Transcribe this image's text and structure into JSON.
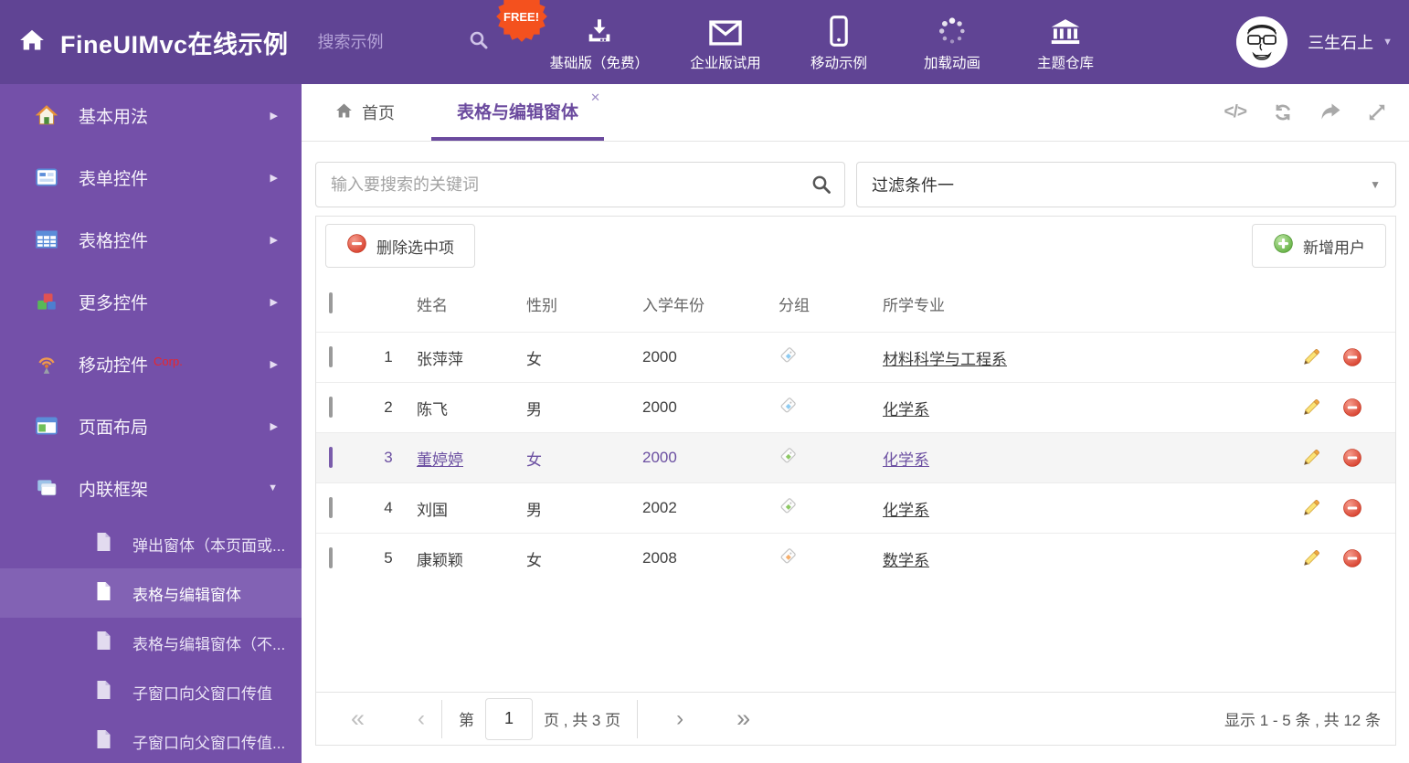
{
  "colors": {
    "header_bg": "#604494",
    "sidebar_bg": "#7450A9",
    "sidebar_active_bg": "#8262B4",
    "accent_purple": "#6B4A9E",
    "free_badge_orange": "#F4511E",
    "delete_red": "#DD3E2B",
    "add_green": "#6FBF4C",
    "selected_row_bg": "#F5F5F5"
  },
  "glyphs": {
    "code": "</>",
    "close": "✕",
    "caret_down": "▼",
    "arrow_right": "▶",
    "first": "«",
    "prev": "‹",
    "next": "›",
    "last": "»"
  },
  "header": {
    "title": "FineUIMvc在线示例",
    "search_placeholder": "搜索示例",
    "nav": [
      {
        "label": "基础版（免费）",
        "badge": "FREE!"
      },
      {
        "label": "企业版试用"
      },
      {
        "label": "移动示例"
      },
      {
        "label": "加载动画"
      },
      {
        "label": "主题仓库"
      }
    ],
    "user_name": "三生石上"
  },
  "sidebar": {
    "items": [
      {
        "label": "基本用法"
      },
      {
        "label": "表单控件"
      },
      {
        "label": "表格控件"
      },
      {
        "label": "更多控件"
      },
      {
        "label": "移动控件",
        "tag": "Corp."
      },
      {
        "label": "页面布局"
      },
      {
        "label": "内联框架"
      }
    ],
    "subitems": [
      {
        "label": "弹出窗体（本页面或..."
      },
      {
        "label": "表格与编辑窗体"
      },
      {
        "label": "表格与编辑窗体（不..."
      },
      {
        "label": "子窗口向父窗口传值"
      },
      {
        "label": "子窗口向父窗口传值..."
      }
    ]
  },
  "tabs": {
    "home": "首页",
    "active": "表格与编辑窗体"
  },
  "filter": {
    "search_placeholder": "输入要搜索的关键词",
    "dropdown_value": "过滤条件一"
  },
  "toolbar": {
    "delete_label": "删除选中项",
    "add_label": "新增用户"
  },
  "table": {
    "columns": {
      "name": "姓名",
      "gender": "性别",
      "year": "入学年份",
      "group": "分组",
      "major": "所学专业"
    },
    "rows": [
      {
        "num": "1",
        "name": "张萍萍",
        "gender": "女",
        "year": "2000",
        "tag_hex": "#8DCBF2",
        "major": "材料科学与工程系"
      },
      {
        "num": "2",
        "name": "陈飞",
        "gender": "男",
        "year": "2000",
        "tag_hex": "#8DCBF2",
        "major": "化学系"
      },
      {
        "num": "3",
        "name": "董婷婷",
        "gender": "女",
        "year": "2000",
        "tag_hex": "#8CC863",
        "major": "化学系"
      },
      {
        "num": "4",
        "name": "刘国",
        "gender": "男",
        "year": "2002",
        "tag_hex": "#8CC863",
        "major": "化学系"
      },
      {
        "num": "5",
        "name": "康颖颖",
        "gender": "女",
        "year": "2008",
        "tag_hex": "#F6AE6B",
        "major": "数学系"
      }
    ]
  },
  "pagination": {
    "prefix": "第",
    "current_page": "1",
    "suffix": "页 , 共 3 页",
    "summary": "显示 1 - 5 条 , 共 12 条"
  }
}
